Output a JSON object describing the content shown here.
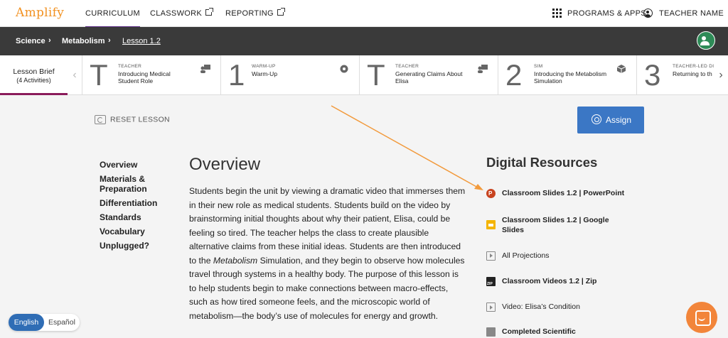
{
  "brand": "Amplify",
  "nav": {
    "curriculum": "CURRICULUM",
    "classwork": "CLASSWORK",
    "reporting": "REPORTING",
    "programs": "PROGRAMS & APPS",
    "user": "TEACHER NAME"
  },
  "breadcrumb": [
    "Science",
    "Metabolism",
    "Lesson 1.2"
  ],
  "lesson_brief": {
    "title": "Lesson Brief",
    "subtitle": "(4 Activities)"
  },
  "activities": [
    {
      "number": "T",
      "kind": "TEACHER",
      "title": "Introducing Medical Student Role",
      "icon": "teacher-icon"
    },
    {
      "number": "1",
      "kind": "WARM-UP",
      "title": "Warm-Up",
      "icon": "brain-icon"
    },
    {
      "number": "T",
      "kind": "TEACHER",
      "title": "Generating Claims About Elisa",
      "icon": "teacher-icon"
    },
    {
      "number": "2",
      "kind": "SIM",
      "title": "Introducing the Metabolism Simulation",
      "icon": "cube-icon"
    },
    {
      "number": "3",
      "kind": "TEACHER-LED DI",
      "title": "Returning to th",
      "icon": "teacher-icon"
    }
  ],
  "reset_label": "RESET LESSON",
  "assign_label": "Assign",
  "sidenav": [
    "Overview",
    "Materials & Preparation",
    "Differentiation",
    "Standards",
    "Vocabulary",
    "Unplugged?"
  ],
  "overview": {
    "heading": "Overview",
    "text_before": "Students begin the unit by viewing a dramatic video that immerses them in their new role as medical students. Students build on the video by brainstorming initial thoughts about why their patient, Elisa, could be feeling so tired. The teacher helps the class to create plausible alternative claims from these initial ideas. Students are then introduced to the ",
    "text_italic": "Metabolism",
    "text_after": " Simulation, and they begin to observe how molecules travel through systems in a healthy body. The purpose of this lesson is to help students begin to make connections between macro-effects, such as how tired someone feels, and the microscopic world of metabolism—the body’s use of molecules for energy and growth."
  },
  "digital_resources": {
    "heading": "Digital Resources",
    "items": [
      {
        "label": "Classroom Slides 1.2 | PowerPoint",
        "icon": "powerpoint-icon",
        "bold": true
      },
      {
        "label": "Classroom Slides 1.2 | Google Slides",
        "icon": "google-slides-icon",
        "bold": true
      },
      {
        "label": "All Projections",
        "icon": "projection-icon",
        "bold": false
      },
      {
        "label": "Classroom Videos 1.2 | Zip",
        "icon": "zip-icon",
        "bold": true
      },
      {
        "label": "Video: Elisa’s Condition",
        "icon": "video-icon",
        "bold": false
      },
      {
        "label": "Completed Scientific",
        "icon": "pdf-icon",
        "bold": true
      }
    ]
  },
  "language": {
    "active": "English",
    "other": "Español"
  },
  "colors": {
    "brand": "#f29222",
    "accent": "#3b77c5",
    "annotation": "#f29a3c",
    "tab_underline": "#5b2a86"
  }
}
